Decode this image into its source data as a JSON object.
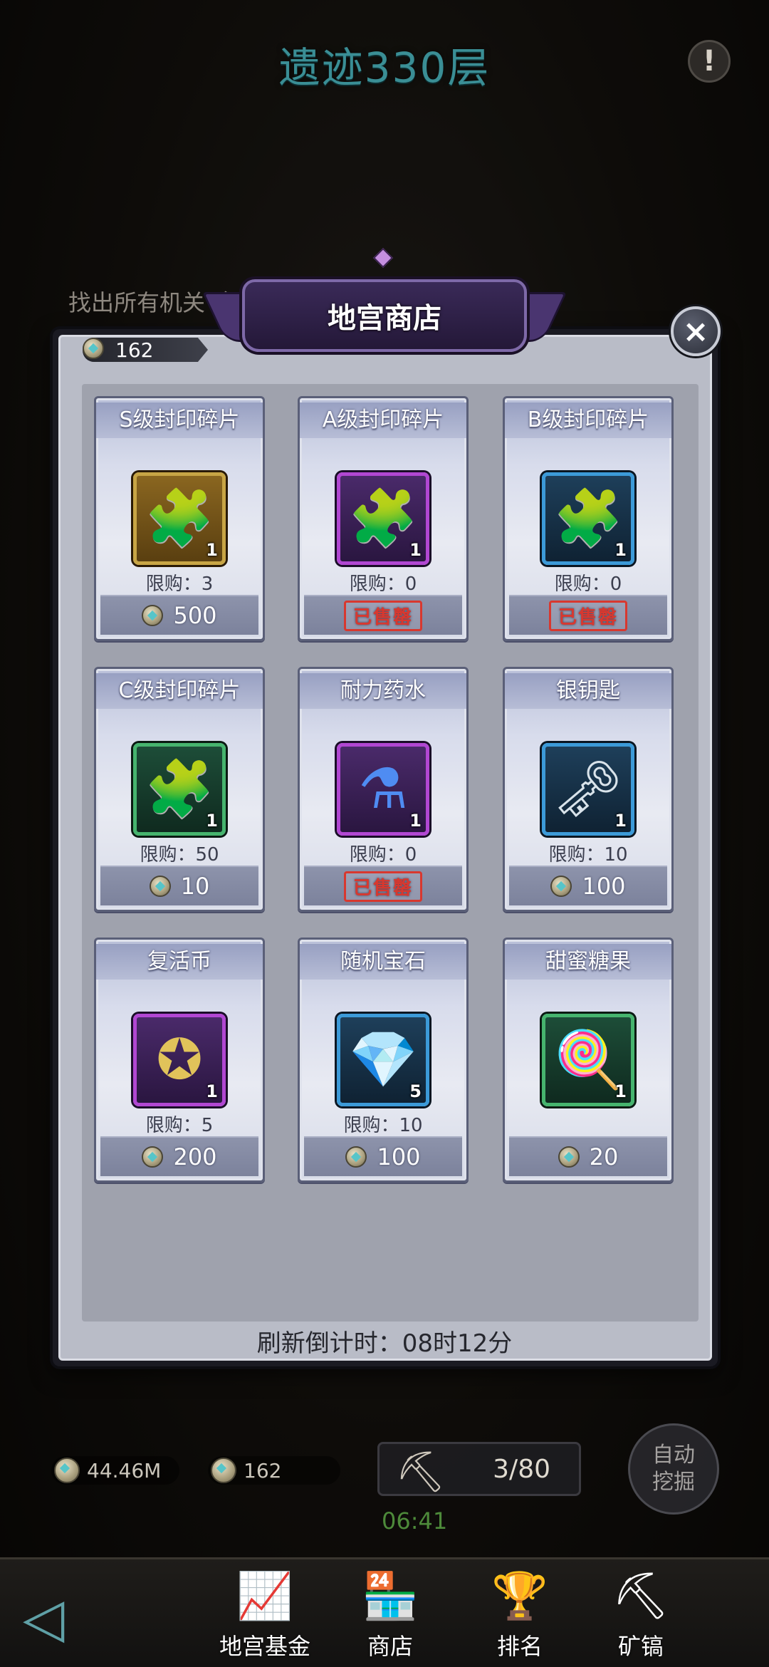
{
  "header": {
    "title": "遗迹330层",
    "alert_icon": "!"
  },
  "quest": {
    "text": "找出所有机关（"
  },
  "shop": {
    "title": "地宫商店",
    "currency": "162",
    "close_icon": "×",
    "items": [
      {
        "name": "S级封印碎片",
        "qty": "1",
        "limit": "限购：3",
        "price": "500",
        "sold": "",
        "rarity": "gold",
        "icon": "puzzle-icon",
        "icon_color": "#f2a03c",
        "icon_glyph": "🧩"
      },
      {
        "name": "A级封印碎片",
        "qty": "1",
        "limit": "限购：0",
        "price": "",
        "sold": "已售罄",
        "rarity": "purple",
        "icon": "puzzle-icon",
        "icon_color": "#c66be8",
        "icon_glyph": "🧩"
      },
      {
        "name": "B级封印碎片",
        "qty": "1",
        "limit": "限购：0",
        "price": "",
        "sold": "已售罄",
        "rarity": "blue",
        "icon": "puzzle-icon",
        "icon_color": "#4cc0ee",
        "icon_glyph": "🧩"
      },
      {
        "name": "C级封印碎片",
        "qty": "1",
        "limit": "限购：50",
        "price": "10",
        "sold": "",
        "rarity": "green",
        "icon": "puzzle-icon",
        "icon_color": "#4fcf7a",
        "icon_glyph": "🧩"
      },
      {
        "name": "耐力药水",
        "qty": "1",
        "limit": "限购：0",
        "price": "",
        "sold": "已售罄",
        "rarity": "purple",
        "icon": "potion-icon",
        "icon_color": "#4f8cf2",
        "icon_glyph": "⚗"
      },
      {
        "name": "银钥匙",
        "qty": "1",
        "limit": "限购：10",
        "price": "100",
        "sold": "",
        "rarity": "blue",
        "icon": "key-icon",
        "icon_color": "#d9e3ea",
        "icon_glyph": "🗝"
      },
      {
        "name": "复活币",
        "qty": "1",
        "limit": "限购：5",
        "price": "200",
        "sold": "",
        "rarity": "purple",
        "icon": "coin-icon",
        "icon_color": "#e1c35a",
        "icon_glyph": "✪"
      },
      {
        "name": "随机宝石",
        "qty": "5",
        "limit": "限购：10",
        "price": "100",
        "sold": "",
        "rarity": "blue",
        "icon": "gem-bag-icon",
        "icon_color": "#b8845a",
        "icon_glyph": "💎"
      },
      {
        "name": "甜蜜糖果",
        "qty": "1",
        "limit": "",
        "price": "20",
        "sold": "",
        "rarity": "green",
        "icon": "candy-icon",
        "icon_color": "#f0a0b0",
        "icon_glyph": "🍭"
      }
    ],
    "refresh": "刷新倒计时：08时12分"
  },
  "resources": {
    "gold": "44.46M",
    "gems": "162",
    "pickaxes": "3/80",
    "timer": "06:41",
    "auto_dig": "自动挖掘"
  },
  "nav": {
    "back_icon": "◁",
    "items": [
      {
        "label": "地宫基金",
        "icon": "fund-icon",
        "glyph": "📈"
      },
      {
        "label": "商店",
        "icon": "shop-icon",
        "glyph": "🏪"
      },
      {
        "label": "排名",
        "icon": "trophy-icon",
        "glyph": "🏆"
      },
      {
        "label": "矿镐",
        "icon": "pickaxe-icon",
        "glyph": "⛏"
      }
    ]
  }
}
